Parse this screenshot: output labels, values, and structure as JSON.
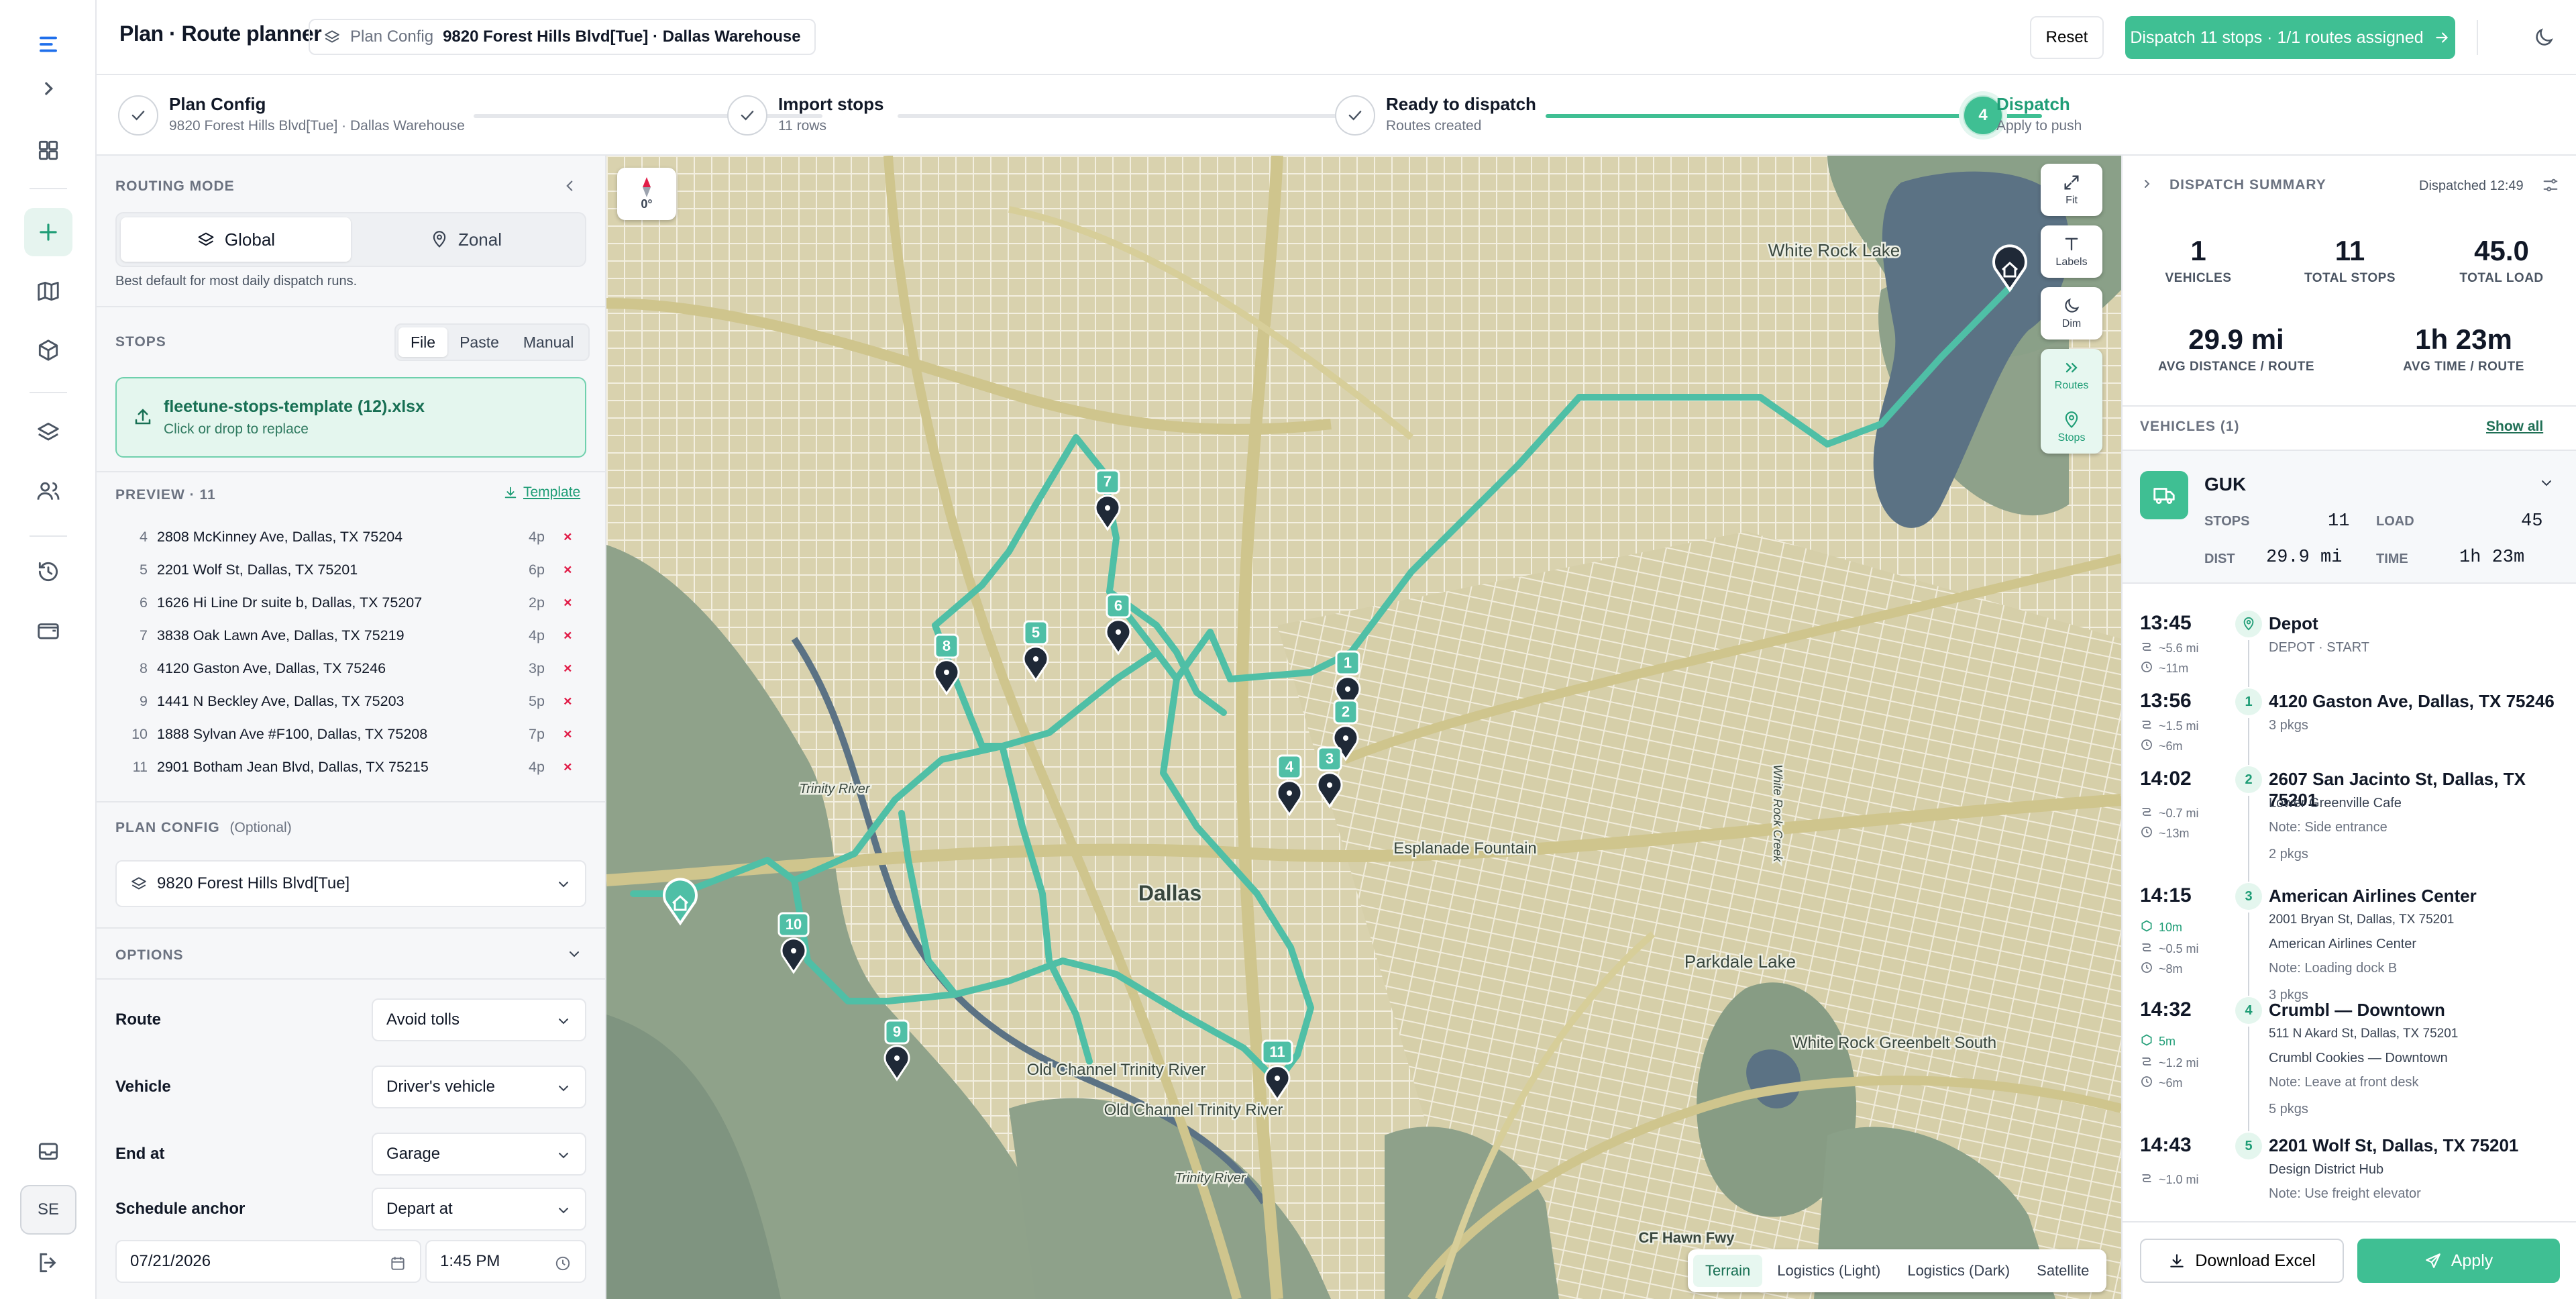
{
  "header": {
    "title": "Plan · Route planner",
    "crumb_label": "Plan Config",
    "crumb_value": "9820 Forest Hills Blvd[Tue] · Dallas Warehouse",
    "reset_label": "Reset",
    "dispatch_label": "Dispatch 11 stops · 1/1 routes assigned"
  },
  "user_initials": "SE",
  "steps": [
    {
      "title": "Plan Config",
      "sub": "9820 Forest Hills Blvd[Tue] · Dallas Warehouse"
    },
    {
      "title": "Import stops",
      "sub": "11 rows"
    },
    {
      "title": "Ready to dispatch",
      "sub": "Routes created"
    },
    {
      "title": "Dispatch",
      "sub": "Apply to push",
      "num": "4"
    }
  ],
  "routing": {
    "label": "ROUTING MODE",
    "global": "Global",
    "zonal": "Zonal",
    "hint": "Best default for most daily dispatch runs."
  },
  "stops": {
    "label": "STOPS",
    "tabs": [
      "File",
      "Paste",
      "Manual"
    ],
    "file_name": "fleetune-stops-template (12).xlsx",
    "file_hint": "Click or drop to replace",
    "preview_label": "PREVIEW · 11",
    "template_link": "Template",
    "rows": [
      {
        "n": "4",
        "addr": "2808 McKinney Ave, Dallas, TX 75204",
        "p": "4p"
      },
      {
        "n": "5",
        "addr": "2201 Wolf St, Dallas, TX 75201",
        "p": "6p"
      },
      {
        "n": "6",
        "addr": "1626 Hi Line Dr suite b, Dallas, TX 75207",
        "p": "2p"
      },
      {
        "n": "7",
        "addr": "3838 Oak Lawn Ave, Dallas, TX 75219",
        "p": "4p"
      },
      {
        "n": "8",
        "addr": "4120 Gaston Ave, Dallas, TX 75246",
        "p": "3p"
      },
      {
        "n": "9",
        "addr": "1441 N Beckley Ave, Dallas, TX 75203",
        "p": "5p"
      },
      {
        "n": "10",
        "addr": "1888 Sylvan Ave #F100, Dallas, TX 75208",
        "p": "7p"
      },
      {
        "n": "11",
        "addr": "2901 Botham Jean Blvd, Dallas, TX 75215",
        "p": "4p"
      }
    ],
    "remove_glyph": "×"
  },
  "plan_config": {
    "label": "PLAN CONFIG",
    "optional": "(Optional)",
    "value": "9820 Forest Hills Blvd[Tue]"
  },
  "options": {
    "label": "OPTIONS",
    "route_label": "Route",
    "route_value": "Avoid tolls",
    "vehicle_label": "Vehicle",
    "vehicle_value": "Driver's vehicle",
    "end_label": "End at",
    "end_value": "Garage",
    "anchor_label": "Schedule anchor",
    "anchor_value": "Depart at",
    "date": "07/21/2026",
    "time": "1:45 PM"
  },
  "map": {
    "compass": "0°",
    "controls": {
      "fit": "Fit",
      "labels": "Labels",
      "dim": "Dim",
      "routes": "Routes",
      "stops": "Stops"
    },
    "styles": [
      "Terrain",
      "Logistics (Light)",
      "Logistics (Dark)",
      "Satellite"
    ],
    "places": [
      "White Rock Lake",
      "Dallas",
      "Esplanade Fountain",
      "Parkdale Lake",
      "White Rock Greenbelt South",
      "Old Channel Trinity River",
      "Old Channel Trinity River",
      "Trinity River",
      "Trinity River",
      "White Rock Creek",
      "CF Hawn Fwy"
    ],
    "markers": [
      "1",
      "2",
      "3",
      "4",
      "5",
      "6",
      "7",
      "8",
      "9",
      "10",
      "11"
    ],
    "route_color": "#4fbfa6"
  },
  "summary": {
    "label": "DISPATCH SUMMARY",
    "dispatched": "Dispatched 12:49",
    "vehicles": "1",
    "vehicles_l": "VEHICLES",
    "total_stops": "11",
    "total_stops_l": "TOTAL STOPS",
    "total_load": "45.0",
    "total_load_l": "TOTAL LOAD",
    "avg_dist": "29.9 mi",
    "avg_dist_l": "AVG DISTANCE / ROUTE",
    "avg_time": "1h 23m",
    "avg_time_l": "AVG TIME / ROUTE",
    "vehicles_section": "VEHICLES (1)",
    "show_all": "Show all"
  },
  "vehicle": {
    "name": "GUK",
    "stops_l": "STOPS",
    "stops": "11",
    "load_l": "LOAD",
    "load": "45",
    "dist_l": "DIST",
    "dist": "29.9 mi",
    "time_l": "TIME",
    "time": "1h 23m"
  },
  "timeline": [
    {
      "time": "13:45",
      "title": "Depot",
      "sub": "DEPOT · START",
      "dist": "~5.6 mi",
      "dur": "~11m"
    },
    {
      "time": "13:56",
      "n": "1",
      "title": "4120 Gaston Ave, Dallas, TX 75246",
      "sub": "3 pkgs",
      "dist": "~1.5 mi",
      "dur": "~6m"
    },
    {
      "time": "14:02",
      "n": "2",
      "title": "2607 San Jacinto St, Dallas, TX 75201",
      "l1": "Lower Greenville Cafe",
      "l2": "Note: Side entrance",
      "l3": "2 pkgs",
      "dist": "~0.7 mi",
      "dur": "~13m"
    },
    {
      "time": "14:15",
      "n": "3",
      "title": "American Airlines Center",
      "addr": "2001 Bryan St, Dallas, TX 75201",
      "l1": "American Airlines Center",
      "l2": "Note: Loading dock B",
      "l3": "3 pkgs",
      "wait": "10m",
      "dist": "~0.5 mi",
      "dur": "~8m"
    },
    {
      "time": "14:32",
      "n": "4",
      "title": "Crumbl — Downtown",
      "addr": "511 N Akard St, Dallas, TX 75201",
      "l1": "Crumbl Cookies — Downtown",
      "l2": "Note: Leave at front desk",
      "l3": "5 pkgs",
      "wait": "5m",
      "dist": "~1.2 mi",
      "dur": "~6m"
    },
    {
      "time": "14:43",
      "n": "5",
      "title": "2201 Wolf St, Dallas, TX 75201",
      "l1": "Design District Hub",
      "l2": "Note: Use freight elevator",
      "dist": "~1.0 mi"
    }
  ],
  "footer": {
    "download": "Download Excel",
    "apply": "Apply"
  }
}
